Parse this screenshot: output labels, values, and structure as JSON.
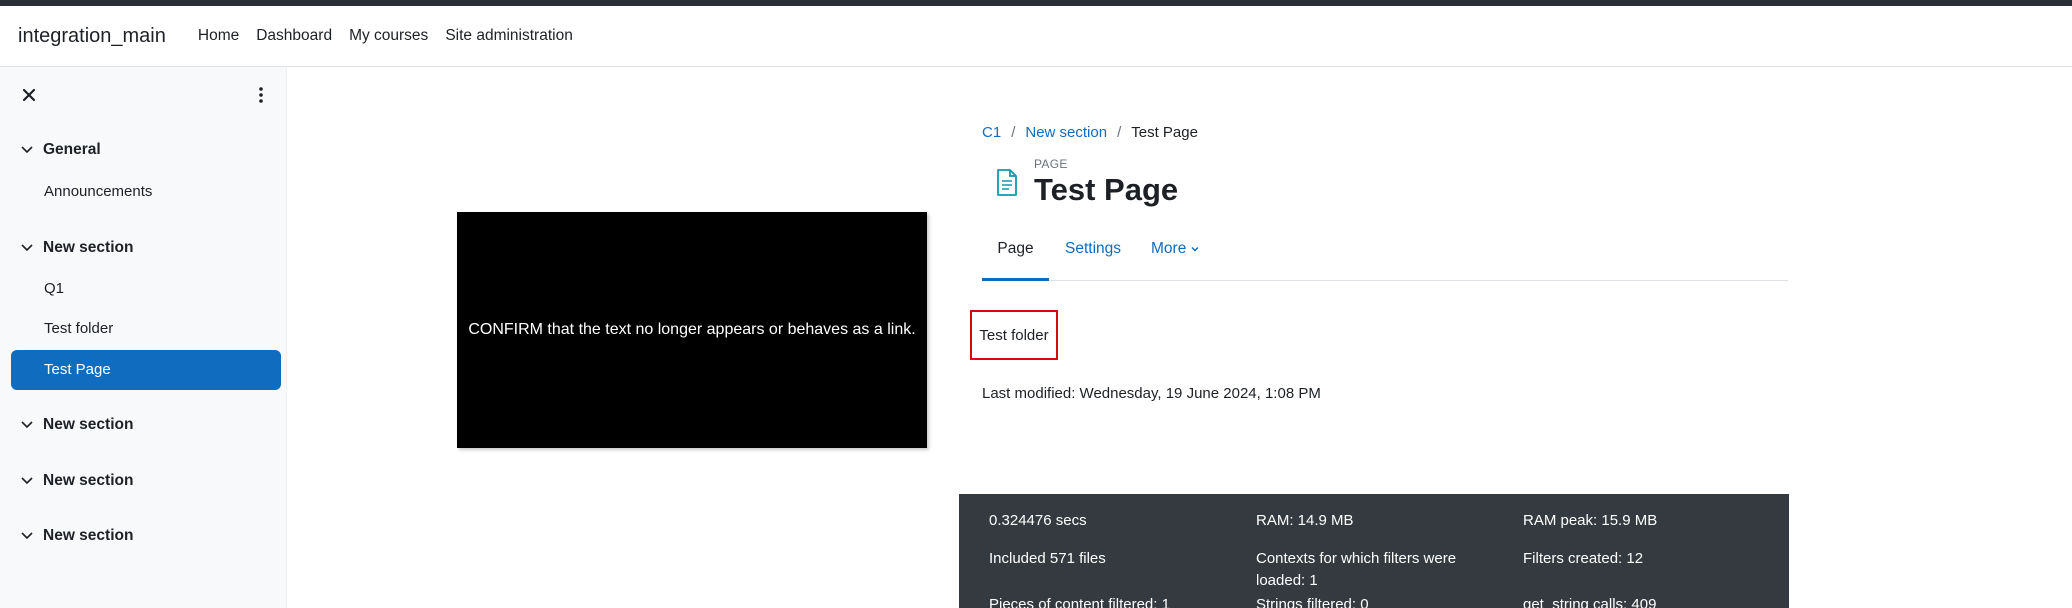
{
  "navbar": {
    "brand": "integration_main",
    "links": [
      "Home",
      "Dashboard",
      "My courses",
      "Site administration"
    ]
  },
  "drawer": {
    "close_icon": "close-icon",
    "menu_icon": "kebab-menu-icon",
    "sections": [
      {
        "title": "General",
        "items": [
          "Announcements"
        ]
      },
      {
        "title": "New section",
        "items": [
          "Q1",
          "Test folder",
          "Test Page"
        ]
      },
      {
        "title": "New section",
        "items": []
      },
      {
        "title": "New section",
        "items": []
      },
      {
        "title": "New section",
        "items": []
      }
    ],
    "active_item": "Test Page"
  },
  "video": {
    "caption": "CONFIRM that the text no longer appears or behaves as a link."
  },
  "breadcrumb": {
    "items": [
      "C1",
      "New section",
      "Test Page"
    ],
    "separator": "/"
  },
  "header": {
    "module_type": "PAGE",
    "title": "Test Page",
    "icon": "page-document-icon"
  },
  "tabs": {
    "page": "Page",
    "settings": "Settings",
    "more": "More"
  },
  "content": {
    "link_text": "Test folder",
    "last_modified": "Last modified: Wednesday, 19 June 2024, 1:08 PM"
  },
  "performance": {
    "cells": [
      "0.324476 secs",
      "RAM: 14.9 MB",
      "RAM peak: 15.9 MB",
      "Included 571 files",
      "Contexts for which filters were loaded: 1",
      "Filters created: 12",
      "Pieces of content filtered: 1",
      "Strings filtered: 0",
      "get_string calls: 409"
    ]
  },
  "colors": {
    "primary": "#0f6cbf",
    "drawer_bg": "#f8f9fa",
    "footer_bg": "#343a40",
    "highlight_border": "#d9080f"
  }
}
